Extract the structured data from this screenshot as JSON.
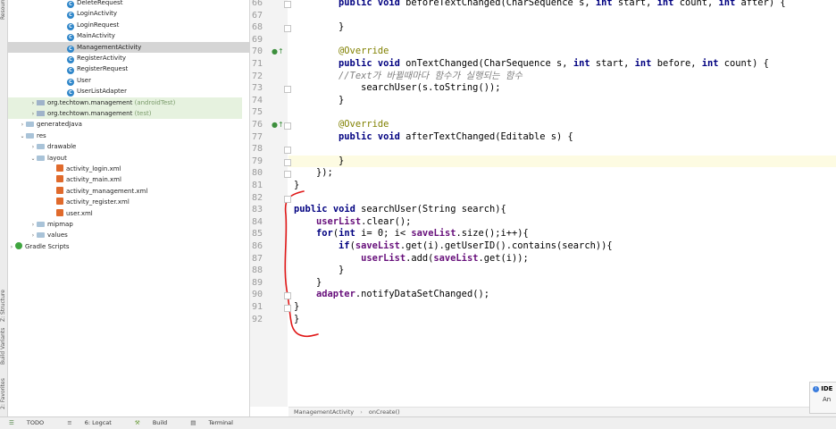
{
  "left_strip": {
    "tabs": [
      "Resource Manager",
      "Z: Structure",
      "Build Variants",
      "2: Favorites"
    ]
  },
  "project_tree": {
    "rows": [
      {
        "label": "DeleteRequest",
        "kind": "class",
        "indent": 66,
        "state": ""
      },
      {
        "label": "LoginActivity",
        "kind": "class",
        "indent": 66,
        "state": ""
      },
      {
        "label": "LoginRequest",
        "kind": "class",
        "indent": 66,
        "state": ""
      },
      {
        "label": "MainActivity",
        "kind": "class",
        "indent": 66,
        "state": ""
      },
      {
        "label": "ManagementActivity",
        "kind": "class",
        "indent": 66,
        "state": "sel"
      },
      {
        "label": "RegisterActivity",
        "kind": "class",
        "indent": 66,
        "state": ""
      },
      {
        "label": "RegisterRequest",
        "kind": "class",
        "indent": 66,
        "state": ""
      },
      {
        "label": "User",
        "kind": "class",
        "indent": 66,
        "state": ""
      },
      {
        "label": "UserListAdapter",
        "kind": "class",
        "indent": 66,
        "state": ""
      },
      {
        "label": "org.techtown.management",
        "suffix": "(androidTest)",
        "kind": "pkg",
        "indent": 32,
        "arrow": "›",
        "state": "test"
      },
      {
        "label": "org.techtown.management",
        "suffix": "(test)",
        "kind": "pkg",
        "indent": 32,
        "arrow": "›",
        "state": "test"
      },
      {
        "label": "generatedJava",
        "kind": "folder",
        "indent": 20,
        "arrow": "›",
        "state": ""
      },
      {
        "label": "res",
        "kind": "folder",
        "indent": 20,
        "arrow": "⌄",
        "state": ""
      },
      {
        "label": "drawable",
        "kind": "folder",
        "indent": 32,
        "arrow": "›",
        "state": ""
      },
      {
        "label": "layout",
        "kind": "folder",
        "indent": 32,
        "arrow": "⌄",
        "state": ""
      },
      {
        "label": "activity_login.xml",
        "kind": "xml",
        "indent": 54,
        "state": ""
      },
      {
        "label": "activity_main.xml",
        "kind": "xml",
        "indent": 54,
        "state": ""
      },
      {
        "label": "activity_management.xml",
        "kind": "xml",
        "indent": 54,
        "state": ""
      },
      {
        "label": "activity_register.xml",
        "kind": "xml",
        "indent": 54,
        "state": ""
      },
      {
        "label": "user.xml",
        "kind": "xml",
        "indent": 54,
        "state": ""
      },
      {
        "label": "mipmap",
        "kind": "folder",
        "indent": 32,
        "arrow": "›",
        "state": ""
      },
      {
        "label": "values",
        "kind": "folder",
        "indent": 32,
        "arrow": "›",
        "state": ""
      },
      {
        "label": "Gradle Scripts",
        "kind": "gradle",
        "indent": 8,
        "arrow": "›",
        "state": ""
      }
    ]
  },
  "editor": {
    "line_numbers": [
      "66",
      "67",
      "68",
      "69",
      "70",
      "71",
      "72",
      "73",
      "74",
      "75",
      "76",
      "77",
      "78",
      "79",
      "80",
      "81",
      "82",
      "83",
      "84",
      "85",
      "86",
      "87",
      "88",
      "89",
      "90",
      "91",
      "92"
    ],
    "gutter_marks": {
      "70": "●↑",
      "76": "●↑"
    },
    "lines": [
      "        public void beforeTextChanged(CharSequence s, int start, int count, int after) {",
      "",
      "        }",
      "",
      "        @Override",
      "        public void onTextChanged(CharSequence s, int start, int before, int count) {",
      "        //Text가 바뀔때마다 함수가 실행되는 함수",
      "            searchUser(s.toString());",
      "        }",
      "",
      "        @Override",
      "        public void afterTextChanged(Editable s) {",
      "",
      "        }",
      "    });",
      "}",
      "",
      "public void searchUser(String search){",
      "    userList.clear();",
      "    for(int i= 0; i< saveList.size();i++){",
      "        if(saveList.get(i).getUserID().contains(search)){",
      "            userList.add(saveList.get(i));",
      "        }",
      "    }",
      "    adapter.notifyDataSetChanged();",
      "}",
      "}"
    ],
    "highlight_line": "79"
  },
  "breadcrumb": {
    "items": [
      "ManagementActivity",
      "onCreate()"
    ],
    "separator": "›"
  },
  "bottom_bar": {
    "items": [
      "TODO",
      "6: Logcat",
      "Build",
      "Terminal"
    ]
  },
  "notification": {
    "title": "IDE",
    "body": "An"
  }
}
